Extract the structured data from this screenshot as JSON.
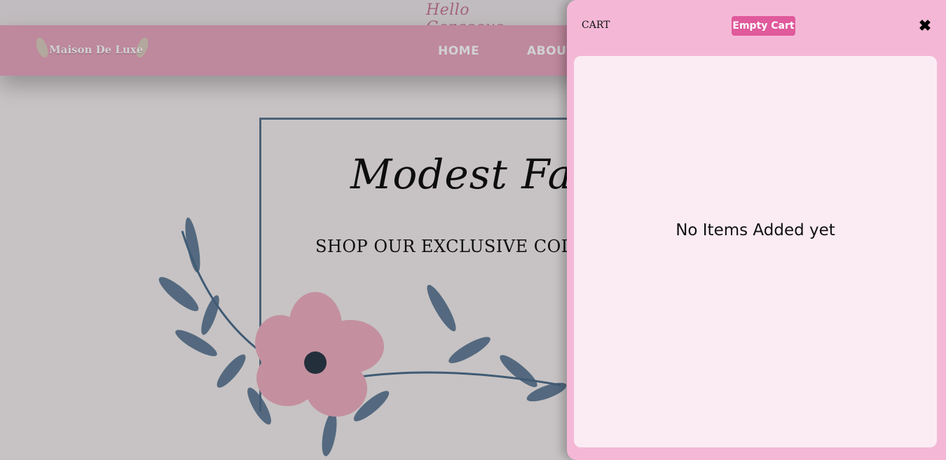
{
  "header": {
    "greeting": "Hello Gorgeous",
    "logo_text": "Maison De Luxe",
    "nav": [
      "HOME",
      "ABOUT"
    ]
  },
  "hero": {
    "title": "Modest Fashion",
    "subtitle": "SHOP OUR EXCLUSIVE COLLEC"
  },
  "cart": {
    "title": "CART",
    "empty_button": "Empty Cart",
    "close_icon": "close-icon",
    "empty_message": "No Items Added yet"
  },
  "colors": {
    "navbar": "#e8a6c0",
    "cart_panel": "#f4b8d6",
    "cart_body": "#fbecf3",
    "button": "#e05a9c",
    "frame": "#5f7891"
  }
}
